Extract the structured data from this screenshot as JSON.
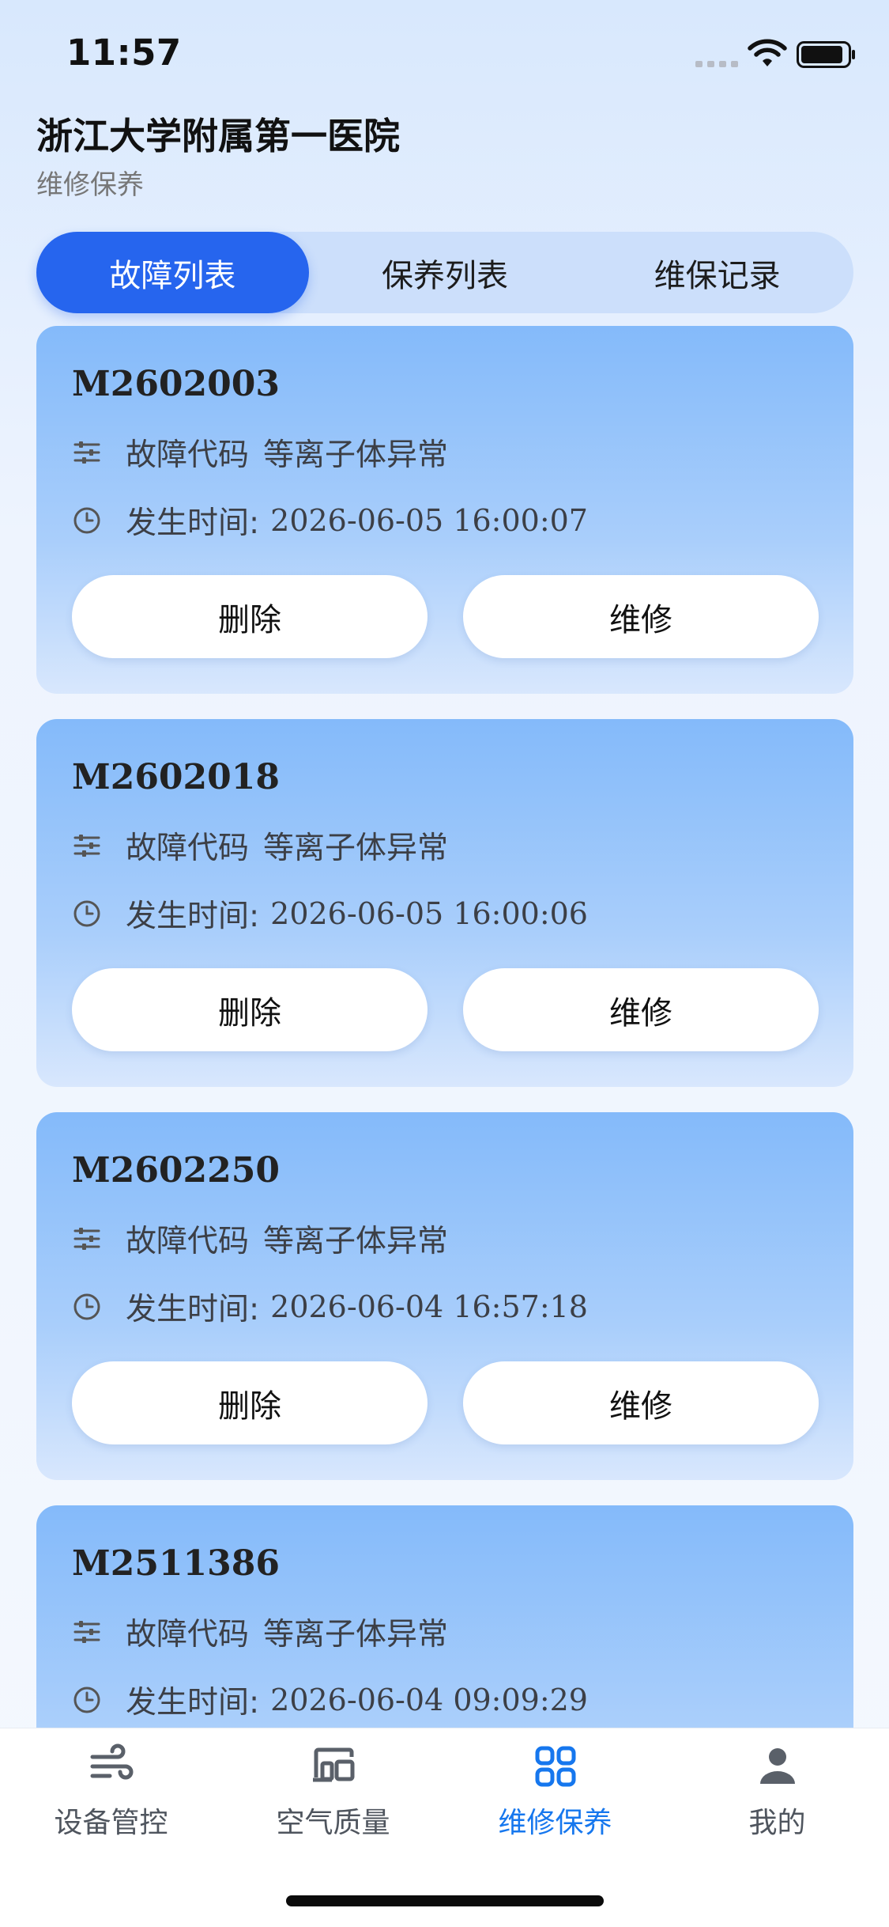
{
  "status_bar": {
    "time": "11:57"
  },
  "header": {
    "title": "浙江大学附属第一医院",
    "subtitle": "维修保养"
  },
  "tabs": [
    {
      "label": "故障列表",
      "active": true
    },
    {
      "label": "保养列表",
      "active": false
    },
    {
      "label": "维保记录",
      "active": false
    }
  ],
  "card_labels": {
    "fault_prefix": "故障代码",
    "time_prefix": "发生时间:",
    "delete_label": "删除",
    "repair_label": "维修"
  },
  "faults": [
    {
      "code": "M2602003",
      "fault": "等离子体异常",
      "time": "2026-06-05 16:00:07"
    },
    {
      "code": "M2602018",
      "fault": "等离子体异常",
      "time": "2026-06-05 16:00:06"
    },
    {
      "code": "M2602250",
      "fault": "等离子体异常",
      "time": "2026-06-04 16:57:18"
    },
    {
      "code": "M2511386",
      "fault": "等离子体异常",
      "time": "2026-06-04 09:09:29"
    }
  ],
  "bottom_nav": [
    {
      "label": "设备管控",
      "icon": "wind-icon",
      "active": false
    },
    {
      "label": "空气质量",
      "icon": "devices-icon",
      "active": false
    },
    {
      "label": "维修保养",
      "icon": "grid-icon",
      "active": true
    },
    {
      "label": "我的",
      "icon": "person-icon",
      "active": false
    }
  ],
  "colors": {
    "accent": "#2665ee",
    "nav_active": "#1677ee",
    "card_top": "#84bafa",
    "card_bottom": "#d8e7fd"
  }
}
